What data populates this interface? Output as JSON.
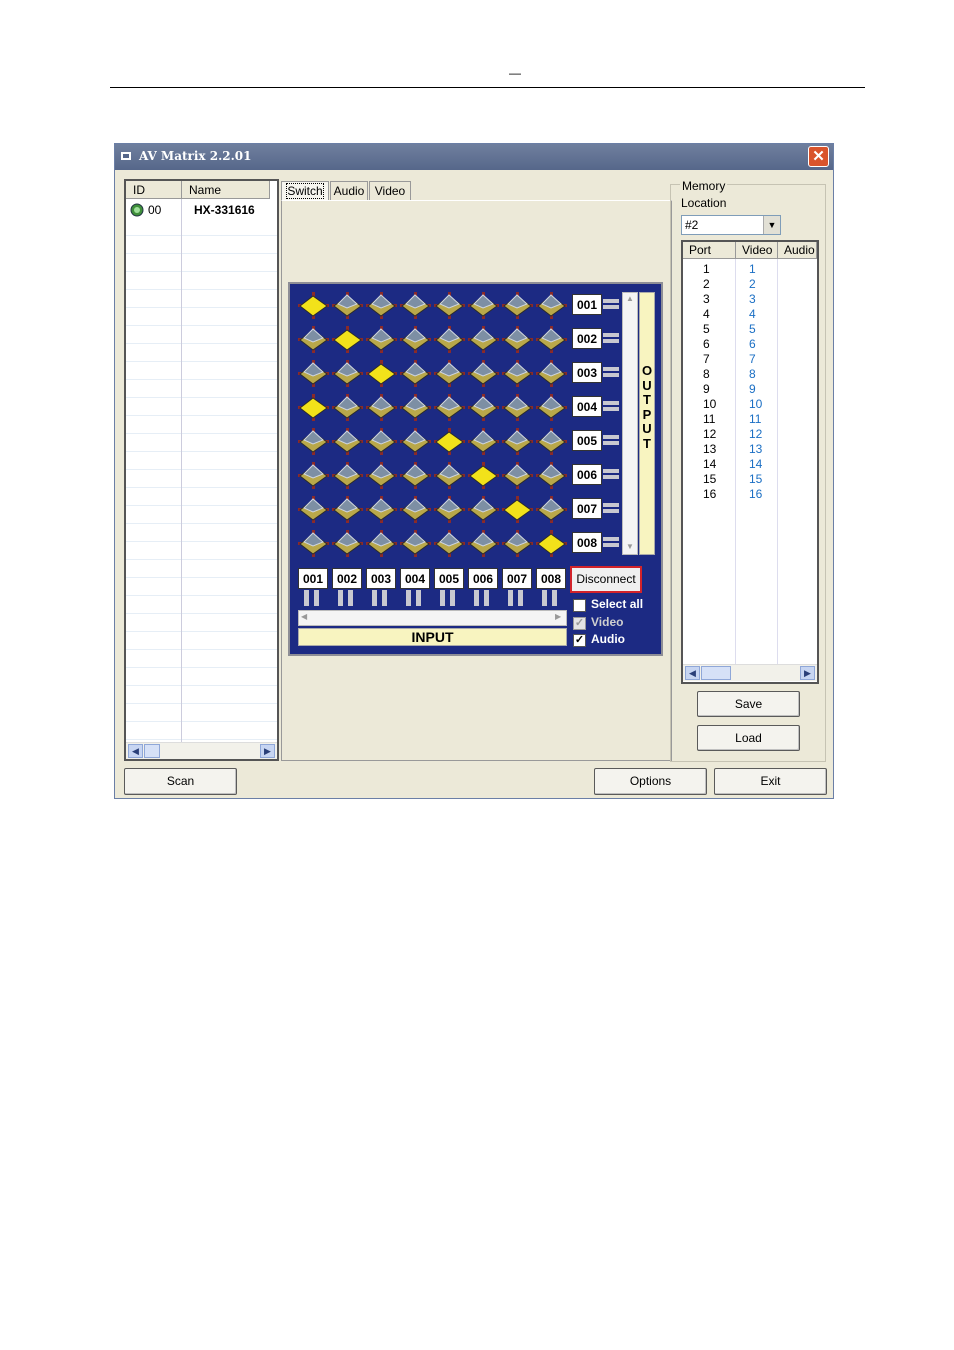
{
  "header": {
    "dash": "—"
  },
  "window": {
    "title": "AV Matrix 2.2.01",
    "close_label": "✕"
  },
  "device_list": {
    "columns": [
      "ID",
      "Name"
    ],
    "rows": [
      {
        "id": "00",
        "name": "HX-331616"
      }
    ]
  },
  "tabs": [
    "Switch",
    "Audio",
    "Video"
  ],
  "matrix": {
    "outputs": [
      "001",
      "002",
      "003",
      "004",
      "005",
      "006",
      "007",
      "008"
    ],
    "inputs": [
      "001",
      "002",
      "003",
      "004",
      "005",
      "006",
      "007",
      "008"
    ],
    "output_label": "OUTPUT",
    "input_label": "INPUT",
    "routing": [
      1,
      2,
      3,
      1,
      5,
      6,
      7,
      8
    ],
    "colors": {
      "background": "#1c2a83",
      "active": "#f2e21a",
      "inactive": "#b9a84a",
      "knob": "#7d8fa4"
    }
  },
  "controls": {
    "disconnect_label": "Disconnect",
    "select_all": {
      "label": "Select all",
      "checked": false
    },
    "video": {
      "label": "Video",
      "checked": true,
      "disabled": true
    },
    "audio": {
      "label": "Audio",
      "checked": true
    }
  },
  "memory": {
    "group_label": "Memory",
    "location_label": "Location",
    "location_value": "#2",
    "columns": [
      "Port",
      "Video",
      "Audio"
    ],
    "rows": [
      {
        "port": "1",
        "video": "1"
      },
      {
        "port": "2",
        "video": "2"
      },
      {
        "port": "3",
        "video": "3"
      },
      {
        "port": "4",
        "video": "4"
      },
      {
        "port": "5",
        "video": "5"
      },
      {
        "port": "6",
        "video": "6"
      },
      {
        "port": "7",
        "video": "7"
      },
      {
        "port": "8",
        "video": "8"
      },
      {
        "port": "9",
        "video": "9"
      },
      {
        "port": "10",
        "video": "10"
      },
      {
        "port": "11",
        "video": "11"
      },
      {
        "port": "12",
        "video": "12"
      },
      {
        "port": "13",
        "video": "13"
      },
      {
        "port": "14",
        "video": "14"
      },
      {
        "port": "15",
        "video": "15"
      },
      {
        "port": "16",
        "video": "16"
      }
    ],
    "save_label": "Save",
    "load_label": "Load"
  },
  "footer": {
    "scan_label": "Scan",
    "options_label": "Options",
    "exit_label": "Exit"
  }
}
